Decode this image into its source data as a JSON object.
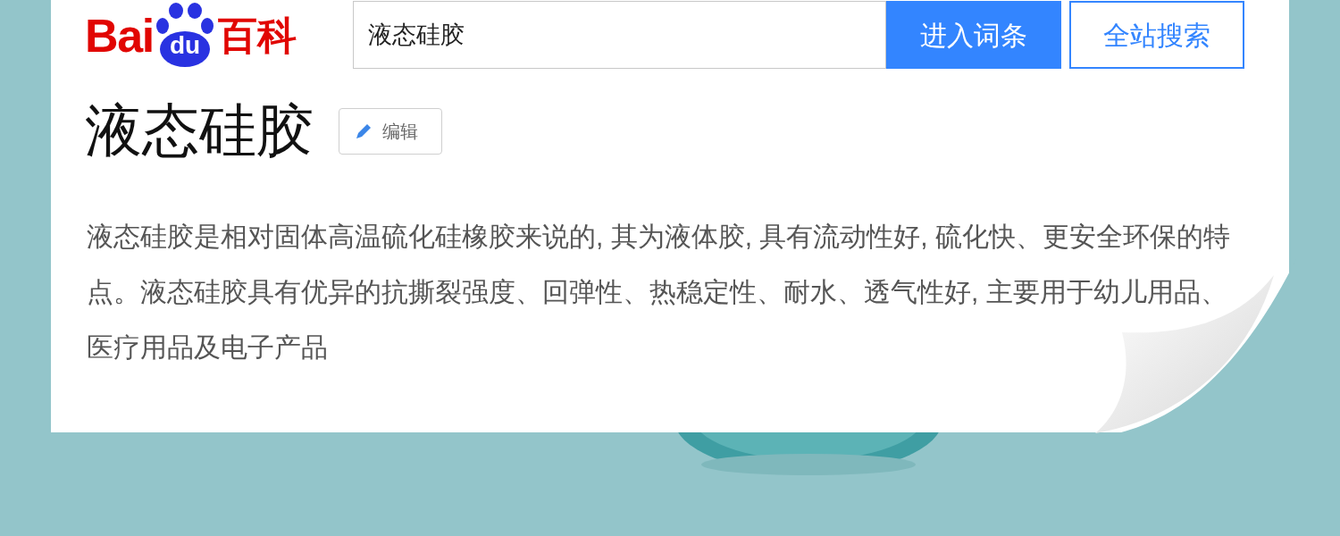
{
  "logo": {
    "text_before": "Bai",
    "paw_text": "du",
    "text_after": "百科"
  },
  "search": {
    "value": "液态硅胶"
  },
  "buttons": [
    {
      "label": "进入词条",
      "kind": "primary"
    },
    {
      "label": "全站搜索",
      "kind": "outline"
    }
  ],
  "entry": {
    "title": "液态硅胶",
    "edit_label": "编辑",
    "summary": "液态硅胶是相对固体高温硫化硅橡胶来说的, 其为液体胶, 具有流动性好, 硫化快、更安全环保的特点。液态硅胶具有优异的抗撕裂强度、回弹性、热稳定性、耐水、透气性好, 主要用于幼儿用品、医疗用品及电子产品"
  }
}
